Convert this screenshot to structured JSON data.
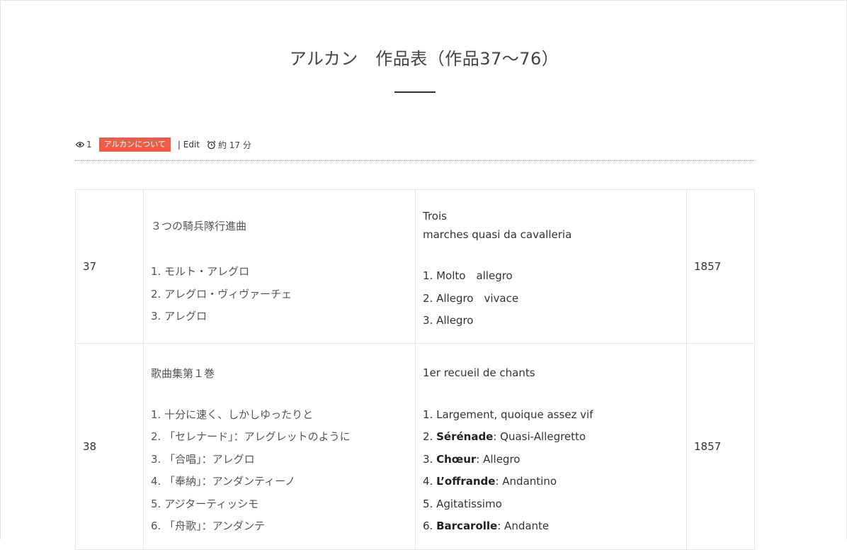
{
  "page": {
    "title": "アルカン　作品表（作品37〜76）"
  },
  "meta": {
    "views": "1",
    "category": "アルカンについて",
    "edit": "| Edit",
    "read_time": "約 17 分",
    "icons": [
      "eye-icon",
      "alarm-clock-icon"
    ],
    "category_color": "#e8604c"
  },
  "table": {
    "rows": [
      {
        "no": "37",
        "ja_title": "３つの騎兵隊行進曲",
        "ja_items": [
          "1. モルト・アレグロ",
          "2. アレグロ・ヴィヴァーチェ",
          "3. アレグロ"
        ],
        "fr_title_1": "Trois",
        "fr_title_2": "marches quasi da cavalleria",
        "fr_items": [
          {
            "num": "1. ",
            "bold": "",
            "rest": "Molto　allegro"
          },
          {
            "num": "2. ",
            "bold": "",
            "rest": "Allegro　vivace"
          },
          {
            "num": "3. ",
            "bold": "",
            "rest": "Allegro"
          }
        ],
        "year": "1857"
      },
      {
        "no": "38",
        "ja_title": "歌曲集第１巻",
        "ja_items": [
          "1. 十分に速く、しかしゆったりと",
          "2. 「セレナード」：アレグレットのように",
          "3. 「合唱」：アレグロ",
          "4. 「奉納」：アンダンティーノ",
          "5. アジターティッシモ",
          "6. 「舟歌」：アンダンテ"
        ],
        "fr_title_1": "1er recueil de chants",
        "fr_items": [
          {
            "num": "1. ",
            "bold": "",
            "rest": "Largement, quoique assez vif"
          },
          {
            "num": "2. ",
            "bold": "Sérénade",
            "rest": ": Quasi-Allegretto"
          },
          {
            "num": "3. ",
            "bold": "Chœur",
            "rest": ": Allegro"
          },
          {
            "num": "4. ",
            "bold": "L’offrande",
            "rest": ": Andantino"
          },
          {
            "num": "5. ",
            "bold": "",
            "rest": "Agitatissimo"
          },
          {
            "num": "6. ",
            "bold": "Barcarolle",
            "rest": ": Andante"
          }
        ],
        "year": "1857"
      }
    ]
  }
}
